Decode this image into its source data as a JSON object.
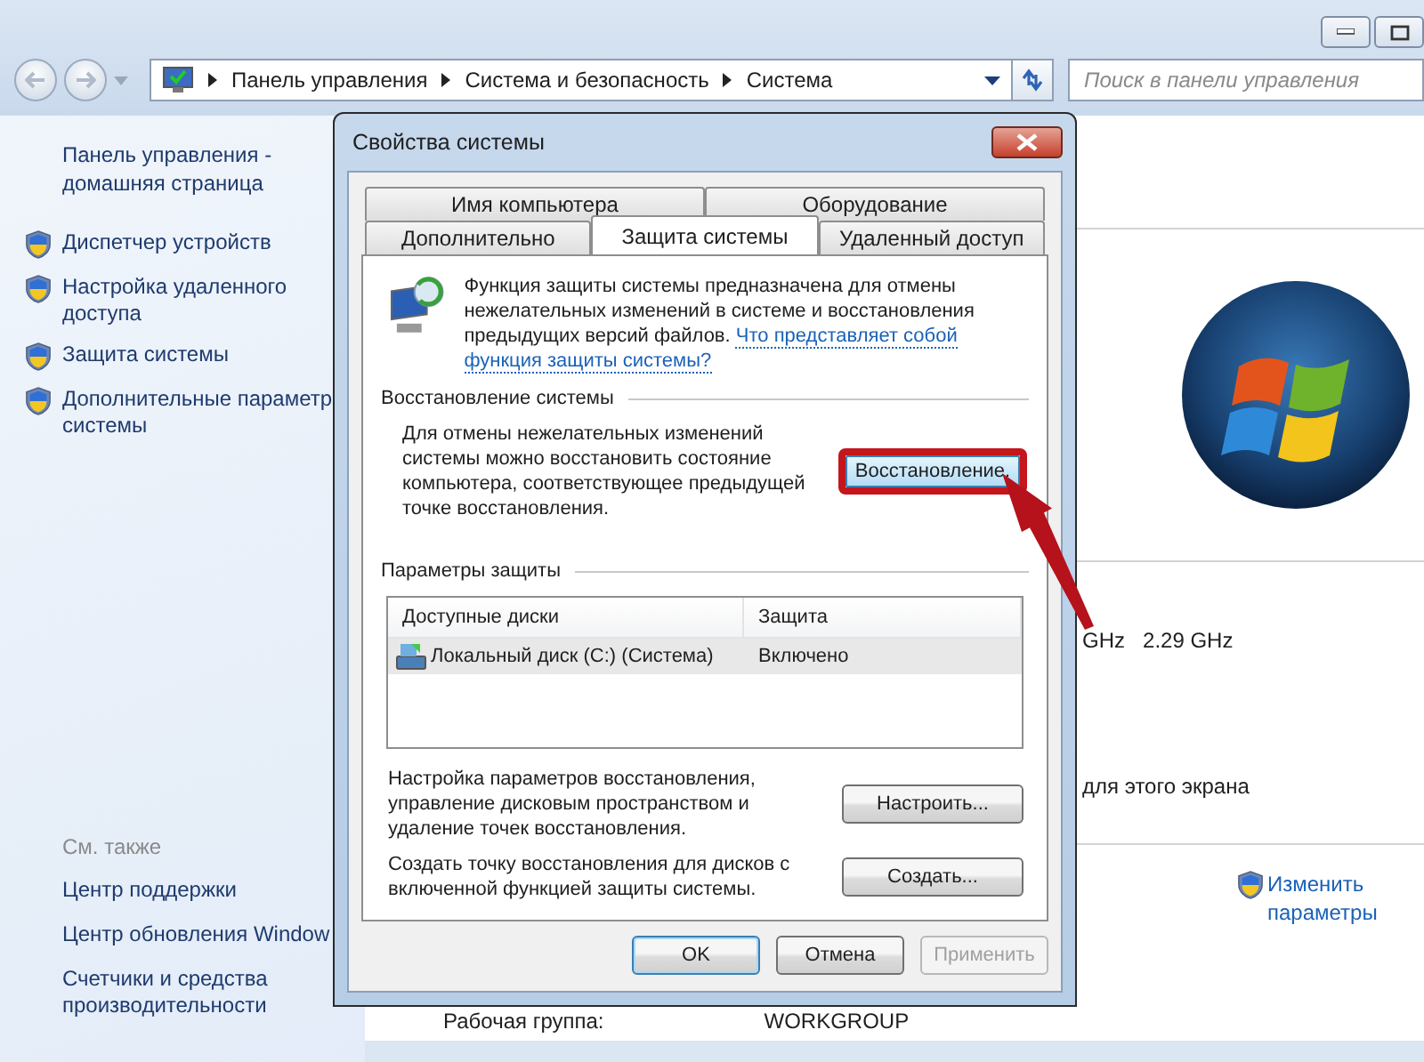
{
  "window": {
    "address": [
      "Панель управления",
      "Система и безопасность",
      "Система"
    ],
    "search": {
      "placeholder": "Поиск в панели управления"
    }
  },
  "sidebar": {
    "home": "Панель управления - домашняя страница",
    "tasks": [
      "Диспетчер устройств",
      "Настройка удаленного доступа",
      "Защита системы",
      "Дополнительные параметр системы"
    ],
    "see_also_title": "См. также",
    "see_also": [
      "Центр поддержки",
      "Центр обновления Window",
      "Счетчики и средства производительности"
    ]
  },
  "content": {
    "processor": [
      "GHz",
      "2.29 GHz"
    ],
    "display_note": "для этого экрана",
    "change_settings": "Изменить параметры",
    "workgroup_label": "Рабочая группа:",
    "workgroup": "WORKGROUP"
  },
  "dialog": {
    "title": "Свойства системы",
    "tab_rows": [
      [
        {
          "label": "Имя компьютера",
          "selected": false
        },
        {
          "label": "Оборудование",
          "selected": false
        }
      ],
      [
        {
          "label": "Дополнительно",
          "selected": false
        },
        {
          "label": "Защита системы",
          "selected": true
        },
        {
          "label": "Удаленный доступ",
          "selected": false
        }
      ]
    ],
    "intro": "Функция защиты системы предназначена для отмены нежелательных изменений в системе и восстановления предыдущих версий файлов.",
    "intro_link": "Что представляет собой функция защиты системы?",
    "restore": {
      "title": "Восстановление системы",
      "text": "Для отмены нежелательных изменений системы можно восстановить состояние компьютера, соответствующее предыдущей точке восстановления.",
      "button": "Восстановление."
    },
    "protection": {
      "title": "Параметры защиты",
      "columns": [
        "Доступные диски",
        "Защита"
      ],
      "rows": [
        {
          "cells": [
            "Локальный диск (C:) (Система)",
            "Включено"
          ],
          "selected": true
        }
      ],
      "configure_text": "Настройка параметров восстановления, управление дисковым пространством и удаление точек восстановления.",
      "configure_button": "Настроить...",
      "create_text": "Создать точку восстановления для дисков с включенной функцией защиты системы.",
      "create_button": "Создать..."
    },
    "buttons": [
      {
        "label": "OK",
        "kind": "default",
        "disabled": false
      },
      {
        "label": "Отмена",
        "kind": "normal",
        "disabled": false
      },
      {
        "label": "Применить",
        "kind": "normal",
        "disabled": true
      }
    ]
  }
}
